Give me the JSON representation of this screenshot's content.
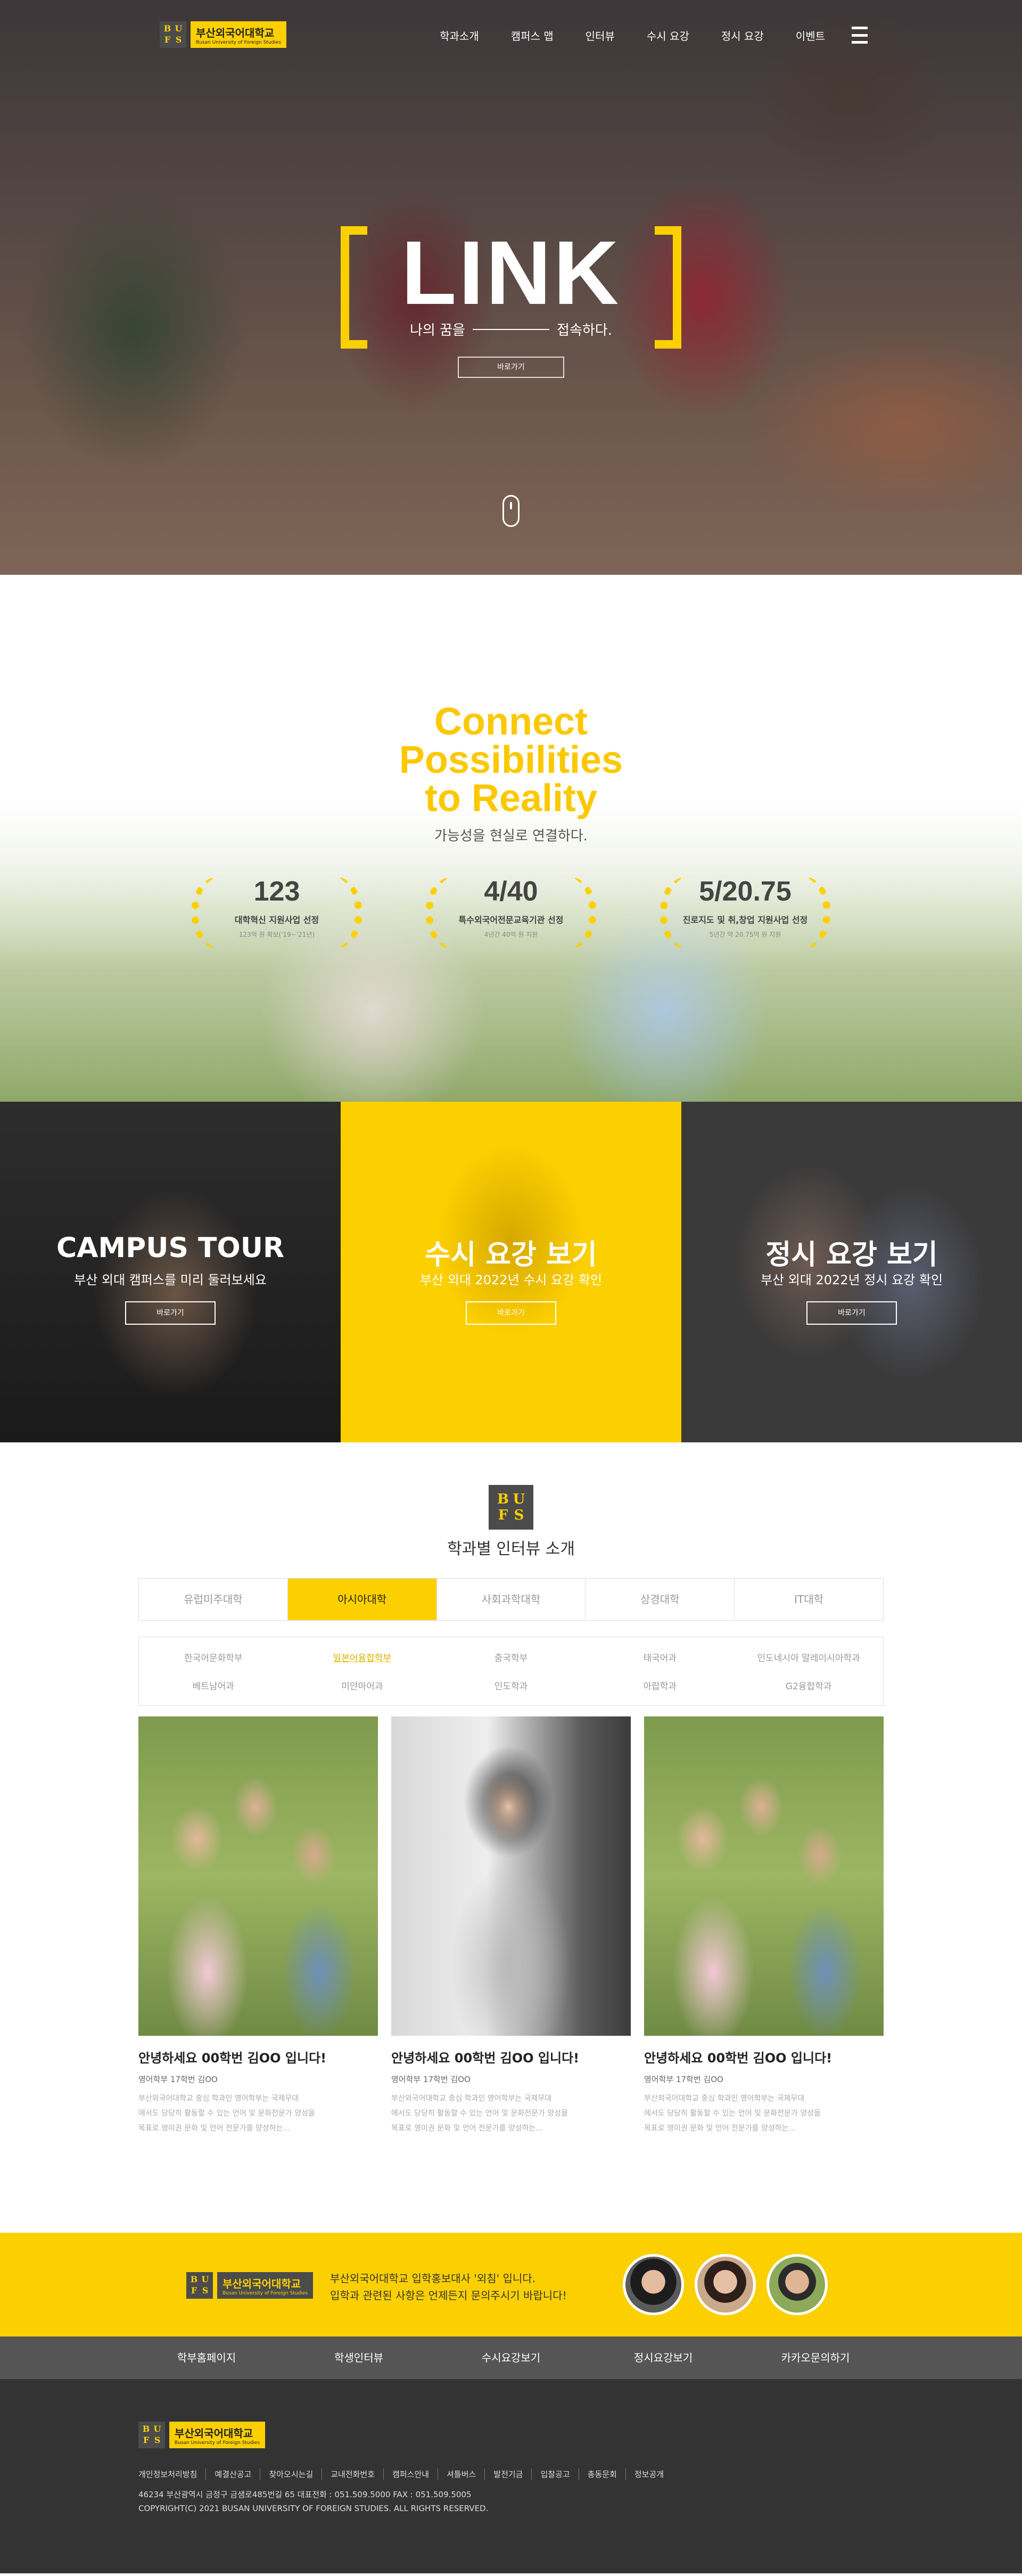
{
  "brand": {
    "mark": [
      "B",
      "U",
      "F",
      "S"
    ],
    "name_ko": "부산외국어대학교",
    "name_en": "Busan University of Foreign Studies"
  },
  "nav": {
    "items": [
      {
        "label": "학과소개"
      },
      {
        "label": "캠퍼스 맵"
      },
      {
        "label": "인터뷰"
      },
      {
        "label": "수시 요강"
      },
      {
        "label": "정시 요강"
      },
      {
        "label": "이벤트"
      }
    ],
    "menu_icon": "hamburger-icon"
  },
  "hero": {
    "title": "LINK",
    "sub_left": "나의 꿈을",
    "sub_right": "접속하다.",
    "button": "바로가기",
    "scroll_icon": "mouse-scroll-icon"
  },
  "connect": {
    "title_lines": [
      "Connect",
      "Possibilities",
      "to Reality"
    ],
    "subtitle": "가능성을 현실로 연결하다.",
    "stats": [
      {
        "value": "123",
        "label": "대학혁신 지원사업 선정",
        "note": "123억 원 확보('19~'21년)"
      },
      {
        "value": "4/40",
        "label": "특수외국어전문교육기관 선정",
        "note": "4년간 40억 원 지원"
      },
      {
        "value": "5/20.75",
        "label": "진로지도 및 취,창업 지원사업 선정",
        "note": "5년간 약 20.75억 원 지원"
      }
    ]
  },
  "panels": [
    {
      "title": "CAMPUS TOUR",
      "subtitle": "부산 외대 캠퍼스를 미리 둘러보세요",
      "button": "바로가기"
    },
    {
      "title": "수시 요강 보기",
      "subtitle": "부산 외대 2022년 수시 요강 확인",
      "button": "바로가기"
    },
    {
      "title": "정시 요강 보기",
      "subtitle": "부산 외대 2022년 정시 요강 확인",
      "button": "바로가기"
    }
  ],
  "interview": {
    "title": "학과별 인터뷰 소개",
    "tabs": [
      "유럽미주대학",
      "아시아대학",
      "사회과학대학",
      "상경대학",
      "IT대학"
    ],
    "active_tab": "아시아대학",
    "departments": [
      "한국어문화학부",
      "일본어융합학부",
      "중국학부",
      "태국어과",
      "인도네시아 말레이시아학과",
      "베트남어과",
      "미얀마어과",
      "인도학과",
      "아랍학과",
      "G2융합학과"
    ],
    "active_department": "일본어융합학부",
    "cards": [
      {
        "name": "안녕하세요 00학번 김OO 입니다!",
        "dept": "영어학부 17학번 김OO",
        "desc": [
          "부산외국어대학교 중심 학과인 영어학부는 국제무대",
          "에서도 당당히 활동할 수 있는 언어 및 문화전문가 양성을",
          "목표로 영미권 문화 및 언어 전문가를 양성하는..."
        ]
      },
      {
        "name": "안녕하세요 00학번 김OO 입니다!",
        "dept": "영어학부 17학번 김OO",
        "desc": [
          "부산외국어대학교 중심 학과인 영어학부는 국제무대",
          "에서도 당당히 활동할 수 있는 언어 및 문화전문가 양성을",
          "목표로 영미권 문화 및 언어 전문가를 양성하는..."
        ]
      },
      {
        "name": "안녕하세요 00학번 김OO 입니다!",
        "dept": "영어학부 17학번 김OO",
        "desc": [
          "부산외국어대학교 중심 학과인 영어학부는 국제무대",
          "에서도 당당히 활동할 수 있는 언어 및 문화전문가 양성을",
          "목표로 영미권 문화 및 언어 전문가를 양성하는..."
        ]
      }
    ]
  },
  "contact": {
    "line1": "부산외국어대학교 입학홍보대사 '외침' 입니다.",
    "line2": "입학과 관련된 사항은 언제든지 문의주시기 바랍니다!"
  },
  "quick_links": [
    "학부홈페이지",
    "학생인터뷰",
    "수시요강보기",
    "정시요강보기",
    "카카오문의하기"
  ],
  "footer": {
    "links": [
      "개인정보처리방침",
      "예결산공고",
      "찾아오시는길",
      "교내전화번호",
      "캠퍼스안내",
      "셔틀버스",
      "발전기금",
      "입찰공고",
      "총동문회",
      "정보공개"
    ],
    "address": "46234 부산광역시 금정구 금샘로485번길 65 대표전화 : 051.509.5000 FAX : 051.509.5005",
    "copyright": "COPYRIGHT(C) 2021 BUSAN UNIVERSITY OF FOREIGN STUDIES. ALL RIGHTS RESERVED."
  }
}
